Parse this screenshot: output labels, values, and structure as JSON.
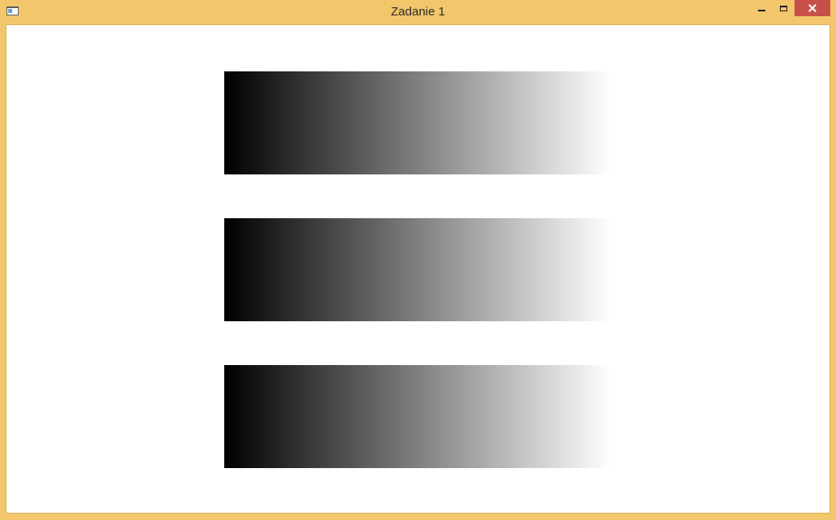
{
  "window": {
    "title": "Zadanie 1",
    "frame_color": "#f2c66b",
    "close_color": "#c7504b"
  },
  "titlebar": {
    "icon": "app-window-icon",
    "controls": [
      "minimize-icon",
      "maximize-icon",
      "close-icon"
    ]
  },
  "content": {
    "gradient_bars": [
      {
        "from": "#000000",
        "to": "#ffffff",
        "direction": "left-to-right"
      },
      {
        "from": "#000000",
        "to": "#ffffff",
        "direction": "left-to-right"
      },
      {
        "from": "#000000",
        "to": "#ffffff",
        "direction": "left-to-right"
      }
    ]
  }
}
